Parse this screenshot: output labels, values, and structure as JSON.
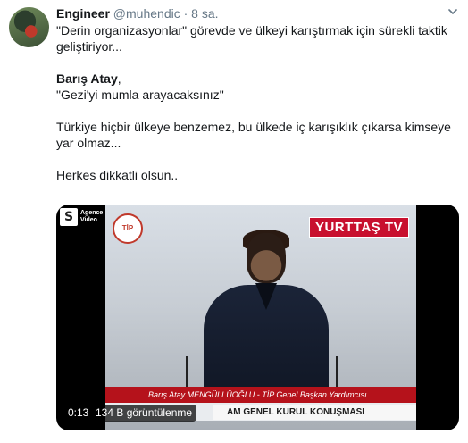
{
  "tweet": {
    "author_name": "Engineer",
    "author_handle": "@muhendic",
    "separator": "·",
    "timestamp": "8 sa.",
    "paragraphs": [
      "\"Derin organizasyonlar\" görevde ve ülkeyi karıştırmak için sürekli taktik geliştiriyor...",
      "",
      "Türkiye hiçbir ülkeye benzemez, bu ülkede iç karışıklık çıkarsa kimseye yar olmaz...",
      "Herkes dikkatli olsun.."
    ],
    "quote_block": {
      "name": "Barış Atay",
      "name_suffix": ",",
      "quote": "\"Gezi'yi mumla arayacaksınız\""
    }
  },
  "media": {
    "type": "video",
    "broadcaster_logo": "YURTTAŞ TV",
    "party_seal": "TİP",
    "corner_logo": "S",
    "corner_logo_text": "Agence\nVideo",
    "lower_third_name": "Barış Atay MENGÜLLÜOĞLU - TİP Genel Başkan Yardımcısı",
    "lower_third_caption": "AM GENEL KURUL KONUŞMASI",
    "duration": "0:13",
    "views": "134 B görüntülenme"
  },
  "icons": {
    "menu_caret": "chevron-down-icon"
  },
  "colors": {
    "link": "#1da1f2",
    "muted": "#657786",
    "brand_red": "#c8102e"
  }
}
